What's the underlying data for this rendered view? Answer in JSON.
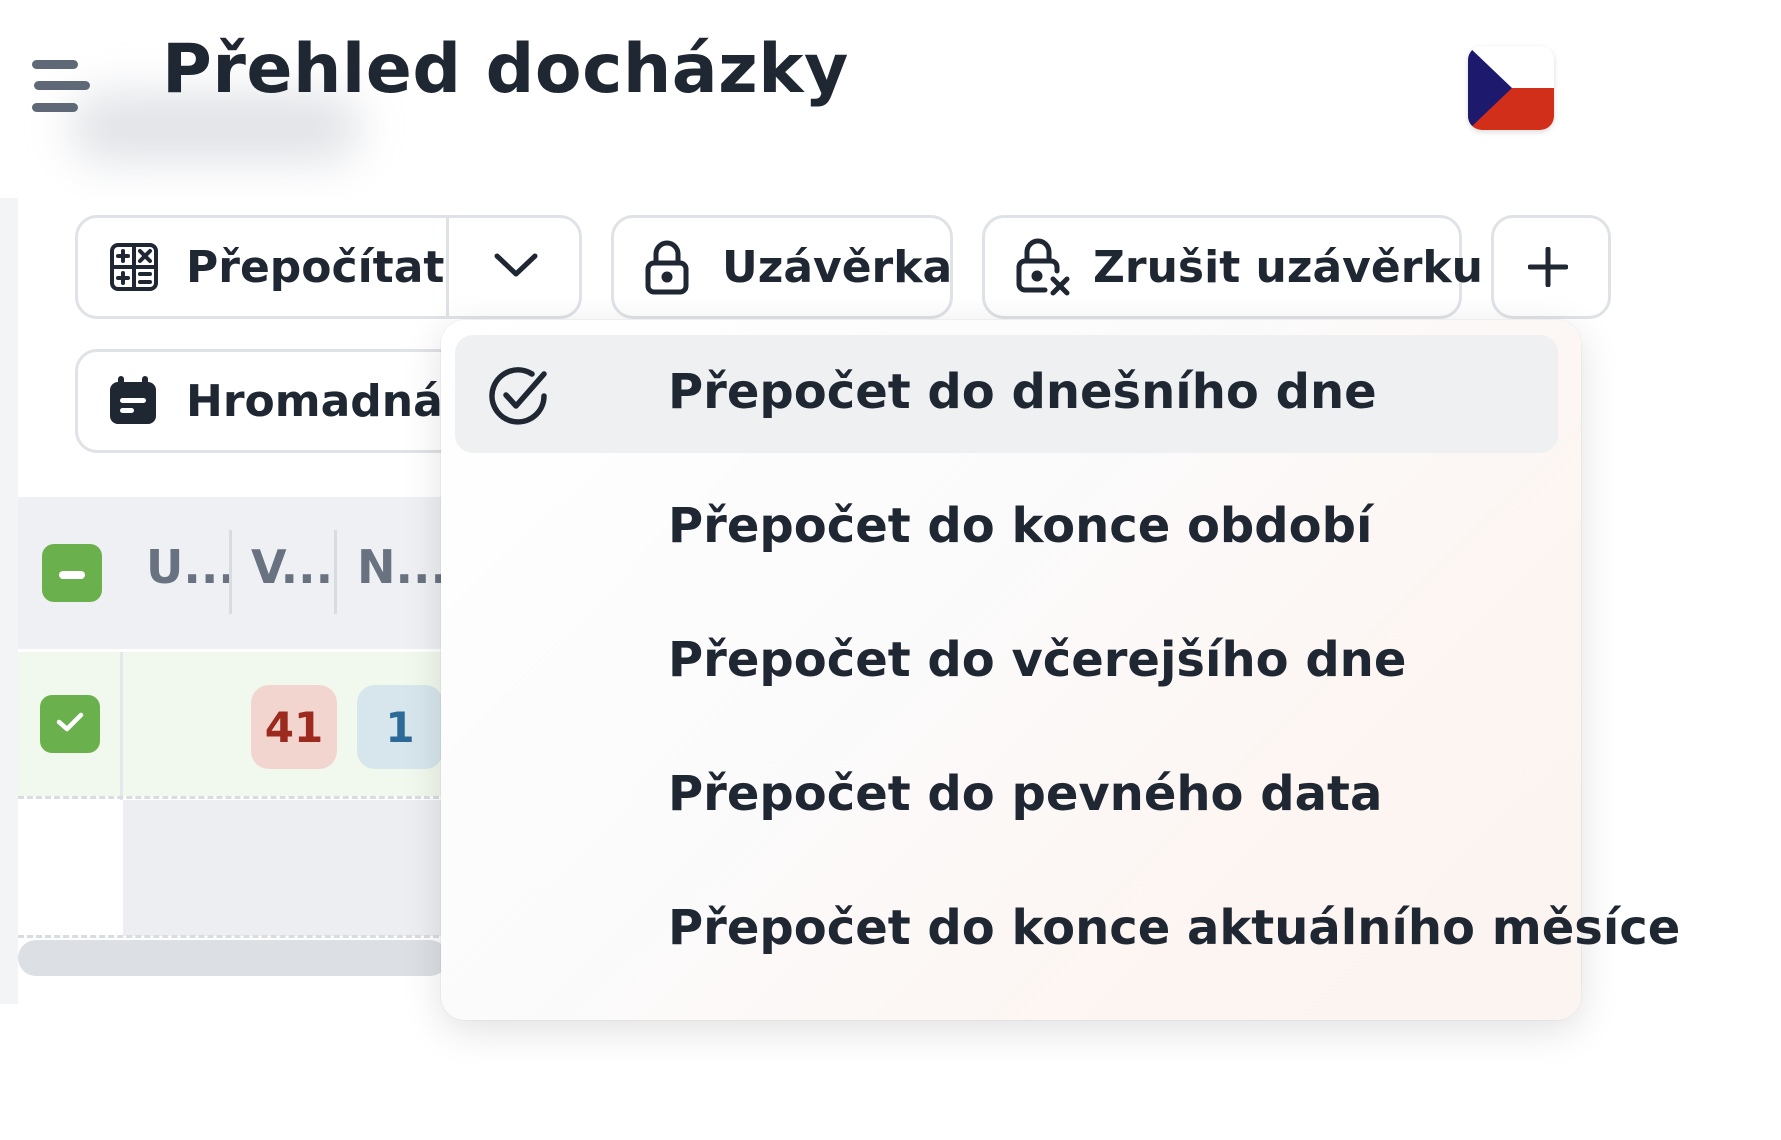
{
  "header": {
    "title": "Přehled docházky",
    "menu_icon": "hamburger-menu-icon",
    "language_flag": "czech-flag-icon"
  },
  "toolbar": {
    "recalculate_label": "Přepočítat",
    "lock_label": "Uzávěrka",
    "unlock_label": "Zrušit uzávěrku",
    "add_icon": "plus-icon",
    "bulk_label": "Hromadná z"
  },
  "table": {
    "columns": [
      "U...",
      "V...",
      "N..."
    ],
    "row1": {
      "badge_red": "41",
      "badge_blue": "1"
    }
  },
  "dropdown": {
    "items": [
      {
        "label": "Přepočet do dnešního dne",
        "selected": true
      },
      {
        "label": "Přepočet do konce období",
        "selected": false
      },
      {
        "label": "Přepočet do včerejšího dne",
        "selected": false
      },
      {
        "label": "Přepočet do pevného data",
        "selected": false
      },
      {
        "label": "Přepočet do konce aktuálního měsíce",
        "selected": false
      }
    ]
  },
  "colors": {
    "accent_green": "#6ab04c",
    "badge_red_bg": "#f3d5cf",
    "badge_red_text": "#9c2a1e",
    "badge_blue_bg": "#d6e6ec",
    "badge_blue_text": "#2d6a98",
    "text_dark": "#1f2733"
  }
}
